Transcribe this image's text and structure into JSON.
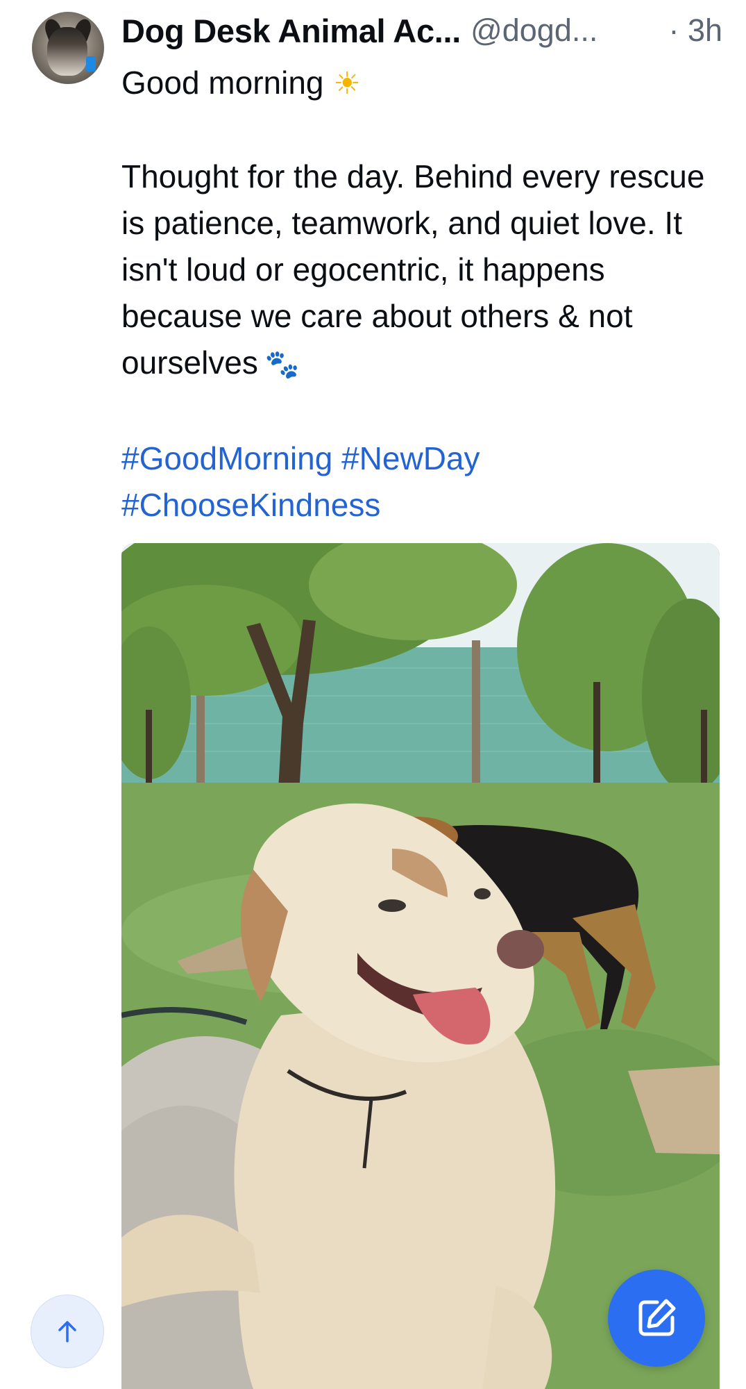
{
  "post": {
    "author": {
      "display_name": "Dog Desk Animal Ac...",
      "handle": "@dogd...",
      "timestamp": "· 3h"
    },
    "body": {
      "line1": "Good morning",
      "line1_emoji": "☀",
      "paragraph": "Thought for the day. Behind every rescue is patience, teamwork, and quiet love. It isn't loud or egocentric, it happens because we care about others & not ourselves",
      "paragraph_emoji": "🐾"
    },
    "hashtags": [
      "#GoodMorning",
      "#NewDay",
      "#ChooseKindness"
    ],
    "media": {
      "kind": "photo"
    }
  },
  "controls": {
    "scroll_top_icon": "arrow-up-icon",
    "compose_icon": "compose-edit-icon"
  },
  "colors": {
    "text": "#0b0f14",
    "muted": "#5b6573",
    "link": "#2364d2",
    "fab": "#2b6ef2",
    "scroll_top_bg": "#e6effb"
  }
}
